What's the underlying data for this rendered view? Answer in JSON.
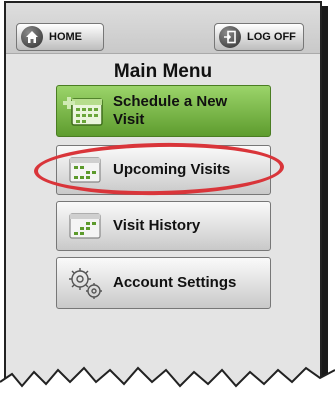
{
  "header": {
    "home_label": "HOME",
    "logoff_label": "LOG OFF"
  },
  "title": "Main Menu",
  "menu": {
    "schedule_label_1": "Schedule a New",
    "schedule_label_2": "Visit",
    "upcoming_label": "Upcoming Visits",
    "history_label": "Visit History",
    "settings_label": "Account Settings"
  },
  "colors": {
    "primary_green": "#6fb13a",
    "highlight_red": "#d9353a"
  }
}
